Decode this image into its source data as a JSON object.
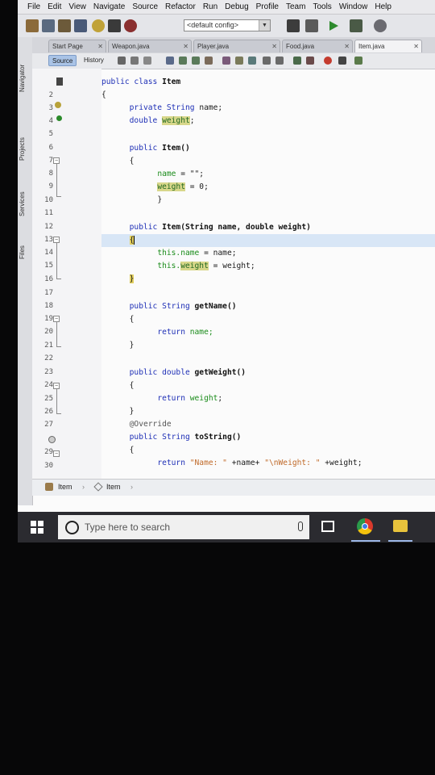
{
  "menu": [
    "File",
    "Edit",
    "View",
    "Navigate",
    "Source",
    "Refactor",
    "Run",
    "Debug",
    "Profile",
    "Team",
    "Tools",
    "Window",
    "Help"
  ],
  "toolbar": {
    "config_value": "<default config>"
  },
  "side_panels": [
    "Navigator",
    "Projects",
    "Services",
    "Files"
  ],
  "tabs": [
    {
      "label": "Start Page"
    },
    {
      "label": "Weapon.java"
    },
    {
      "label": "Player.java"
    },
    {
      "label": "Food.java"
    },
    {
      "label": "Item.java",
      "active": true
    }
  ],
  "editor_toolbar": {
    "source_label": "Source",
    "history_label": "History"
  },
  "line_numbers": [
    "",
    "2",
    "3",
    "4",
    "5",
    "6",
    "7",
    "8",
    "9",
    "10",
    "11",
    "12",
    "13",
    "14",
    "15",
    "16",
    "17",
    "18",
    "19",
    "20",
    "21",
    "22",
    "23",
    "24",
    "25",
    "26",
    "27",
    "",
    "29",
    "30"
  ],
  "code": {
    "l1_kw": "public class",
    "l1_name": "Item",
    "l2": "{",
    "l3_kw": "private",
    "l3_type": "String",
    "l3_name": "name;",
    "l4_type": "double",
    "l4_field": "weight",
    "l4_end": ";",
    "l6_kw": "public",
    "l6_sig": "Item()",
    "l7": "{",
    "l8_a": "name",
    "l8_b": "= \"\";",
    "l9_field": "weight",
    "l9_b": "= 0;",
    "l10": "}",
    "l12_kw": "public",
    "l12_sig": "Item(String name, double weight)",
    "l13": "{",
    "l14_a": "this.name",
    "l14_b": "= name;",
    "l15_a": "this.",
    "l15_field": "weight",
    "l15_b": "= weight;",
    "l16": "}",
    "l18_kw": "public String",
    "l18_sig": "getName()",
    "l19": "{",
    "l20_kw": "return",
    "l20_b": "name;",
    "l21": "}",
    "l23_kw": "public double",
    "l23_sig": "getWeight()",
    "l24": "{",
    "l25_kw": "return",
    "l25_field": "weight",
    "l25_end": ";",
    "l26": "}",
    "l27": "@Override",
    "l28_kw": "public String",
    "l28_sig": "toString()",
    "l29": "{",
    "l30_kw": "return",
    "l30_s1": "\"Name: \"",
    "l30_mid": "+name+",
    "l30_s2": "\"\\nWeight: \"",
    "l30_end": "+weight;"
  },
  "breadcrumbs": [
    "Item",
    "Item"
  ],
  "taskbar": {
    "search_placeholder": "Type here to search"
  },
  "colors": {
    "keyword": "#1e2fb6",
    "highlight": "#d8d78a",
    "current_line": "#d8e6f6",
    "taskbar": "#2b2b30"
  }
}
